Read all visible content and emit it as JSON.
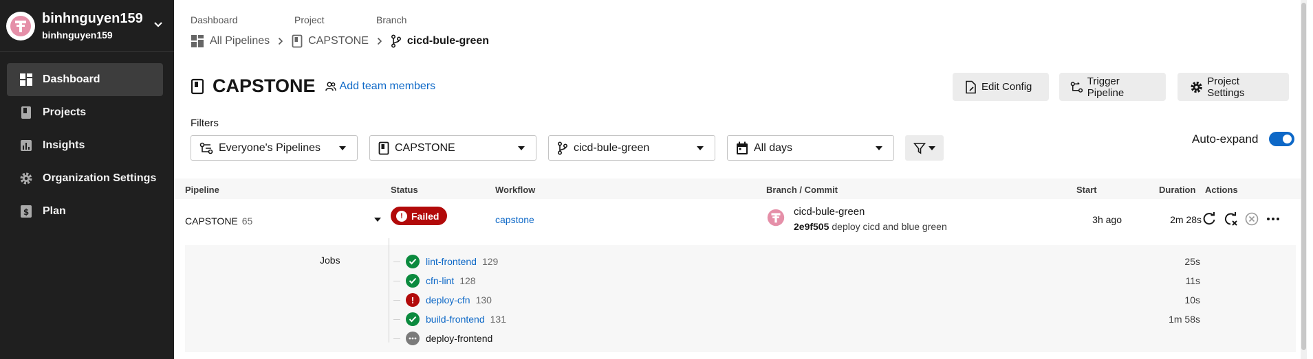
{
  "org": {
    "name": "binhnguyen159",
    "subname": "binhnguyen159"
  },
  "sidebar": {
    "items": [
      {
        "label": "Dashboard",
        "icon": "dashboard-icon",
        "active": true
      },
      {
        "label": "Projects",
        "icon": "projects-icon"
      },
      {
        "label": "Insights",
        "icon": "insights-icon"
      },
      {
        "label": "Organization Settings",
        "icon": "gear-icon"
      },
      {
        "label": "Plan",
        "icon": "plan-icon"
      }
    ]
  },
  "breadcrumb": {
    "labels": [
      "Dashboard",
      "Project",
      "Branch"
    ],
    "items": [
      "All Pipelines",
      "CAPSTONE",
      "cicd-bule-green"
    ]
  },
  "header": {
    "title": "CAPSTONE",
    "add_team": "Add team members",
    "buttons": [
      "Edit Config",
      "Trigger Pipeline",
      "Project Settings"
    ]
  },
  "filters": {
    "label": "Filters",
    "pipelines": "Everyone's Pipelines",
    "project": "CAPSTONE",
    "branch": "cicd-bule-green",
    "days": "All days",
    "auto_expand": "Auto-expand"
  },
  "table": {
    "headers": [
      "Pipeline",
      "Status",
      "Workflow",
      "Branch / Commit",
      "Start",
      "Duration",
      "Actions"
    ],
    "row": {
      "pipeline": "CAPSTONE",
      "number": "65",
      "status": "Failed",
      "workflow": "capstone",
      "branch": "cicd-bule-green",
      "commit_sha": "2e9f505",
      "commit_msg": "deploy cicd and blue green",
      "start": "3h ago",
      "duration": "2m 28s"
    },
    "jobs_label": "Jobs",
    "jobs": [
      {
        "name": "lint-frontend",
        "number": "129",
        "status": "success",
        "duration": "25s"
      },
      {
        "name": "cfn-lint",
        "number": "128",
        "status": "success",
        "duration": "11s"
      },
      {
        "name": "deploy-cfn",
        "number": "130",
        "status": "failed",
        "duration": "10s"
      },
      {
        "name": "build-frontend",
        "number": "131",
        "status": "success",
        "duration": "1m 58s"
      },
      {
        "name": "deploy-frontend",
        "number": "",
        "status": "blocked",
        "duration": ""
      }
    ]
  },
  "colors": {
    "accent": "#0d68c7",
    "failed": "#b20a0a",
    "success": "#0b8a3e",
    "sidebar": "#1f1f1f"
  }
}
